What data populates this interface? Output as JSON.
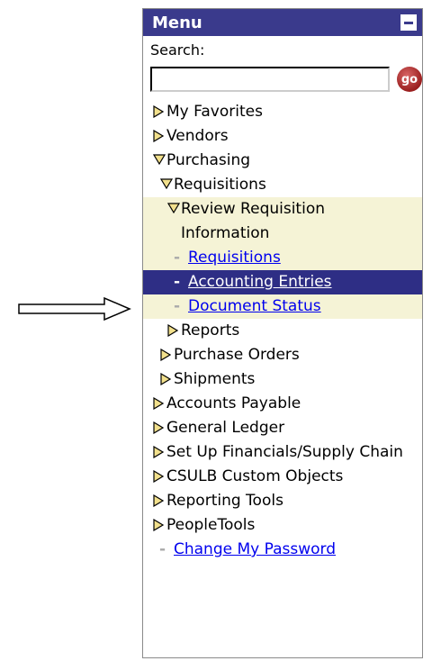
{
  "menu": {
    "title": "Menu",
    "search_label": "Search:",
    "search_value": "",
    "go_label": "go"
  },
  "items": [
    {
      "label": "My Favorites",
      "type": "folder",
      "state": "collapsed",
      "level": 0
    },
    {
      "label": "Vendors",
      "type": "folder",
      "state": "collapsed",
      "level": 0
    },
    {
      "label": "Purchasing",
      "type": "folder",
      "state": "expanded",
      "level": 0
    },
    {
      "label": "Requisitions",
      "type": "folder",
      "state": "expanded",
      "level": 1
    },
    {
      "label": "Review Requisition Information",
      "type": "folder",
      "state": "expanded",
      "level": 2
    },
    {
      "label": "Requisitions",
      "type": "link",
      "level": 3
    },
    {
      "label": "Accounting Entries",
      "type": "link",
      "level": 3,
      "selected": true
    },
    {
      "label": "Document Status",
      "type": "link",
      "level": 3
    },
    {
      "label": "Reports",
      "type": "folder",
      "state": "collapsed",
      "level": 2
    },
    {
      "label": "Purchase Orders",
      "type": "folder",
      "state": "collapsed",
      "level": 1
    },
    {
      "label": "Shipments",
      "type": "folder",
      "state": "collapsed",
      "level": 1
    },
    {
      "label": "Accounts Payable",
      "type": "folder",
      "state": "collapsed",
      "level": 0
    },
    {
      "label": "General Ledger",
      "type": "folder",
      "state": "collapsed",
      "level": 0
    },
    {
      "label": "Set Up Financials/Supply Chain",
      "type": "folder",
      "state": "collapsed",
      "level": 0
    },
    {
      "label": "CSULB Custom Objects",
      "type": "folder",
      "state": "collapsed",
      "level": 0
    },
    {
      "label": "Reporting Tools",
      "type": "folder",
      "state": "collapsed",
      "level": 0
    },
    {
      "label": "PeopleTools",
      "type": "folder",
      "state": "collapsed",
      "level": 0
    },
    {
      "label": "Change My Password",
      "type": "link",
      "level": 0
    }
  ],
  "colors": {
    "header_bg": "#3a3a8c",
    "selected_bg": "#2e2e85",
    "highlight_bg": "#f5f3d6",
    "link": "#0000ee",
    "triangle_fill": "#f2e08c"
  },
  "icons": {
    "collapsed": "triangle-right-icon",
    "expanded": "triangle-down-icon",
    "leaf": "dash-icon",
    "pointer": "arrow-right-icon"
  }
}
